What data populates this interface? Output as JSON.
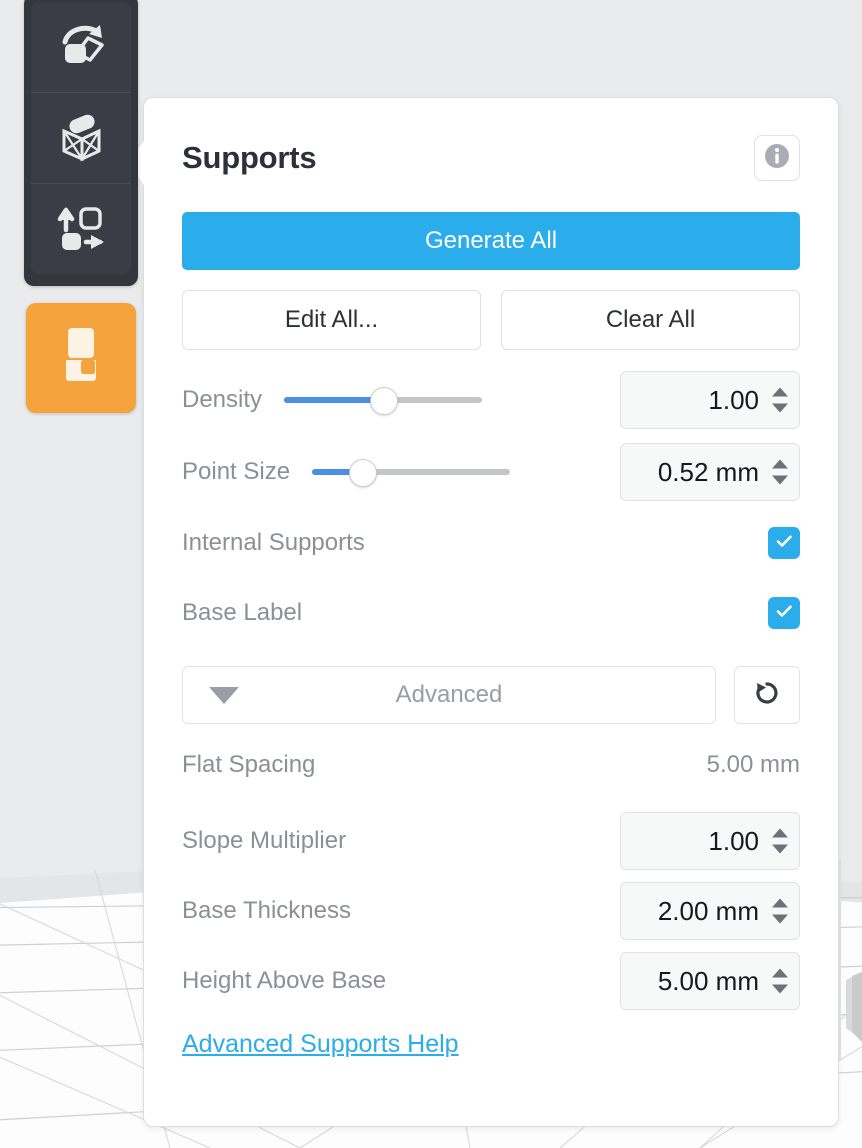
{
  "toolbar": {
    "items": [
      {
        "name": "orient-tool",
        "icon": "rotate-object-icon",
        "active": false
      },
      {
        "name": "supports-tool",
        "icon": "supports-scaffold-icon",
        "active": true
      },
      {
        "name": "layout-tool",
        "icon": "arrange-layout-icon",
        "active": false
      }
    ],
    "action_button": {
      "name": "print-setup-button",
      "icon": "printer-cartridge-icon",
      "color": "#f5a33c"
    }
  },
  "panel": {
    "title": "Supports",
    "info_icon": "info-circle-icon",
    "primary_action": "Generate All",
    "secondary_actions": [
      "Edit All...",
      "Clear All"
    ],
    "sliders": [
      {
        "label": "Density",
        "value": "1.00",
        "percent": 50
      },
      {
        "label": "Point Size",
        "value": "0.52 mm",
        "percent": 25
      }
    ],
    "checkboxes": [
      {
        "label": "Internal Supports",
        "checked": true
      },
      {
        "label": "Base Label",
        "checked": true
      }
    ],
    "advanced": {
      "label": "Advanced",
      "caret_icon": "chevron-down-icon",
      "reset_icon": "reset-rotate-ccw-icon"
    },
    "advanced_fields": [
      {
        "label": "Flat Spacing",
        "value": "5.00 mm",
        "readonly": true
      },
      {
        "label": "Slope Multiplier",
        "value": "1.00",
        "readonly": false
      },
      {
        "label": "Base Thickness",
        "value": "2.00 mm",
        "readonly": false
      },
      {
        "label": "Height Above Base",
        "value": "5.00 mm",
        "readonly": false
      }
    ],
    "help_link": "Advanced Supports Help"
  },
  "colors": {
    "accent_blue": "#2badeb",
    "slider_blue": "#4a90e2",
    "orange": "#f5a33c",
    "toolbar_dark": "#3a3d45",
    "label_gray": "#8b8f98",
    "background": "#e9ebec"
  }
}
